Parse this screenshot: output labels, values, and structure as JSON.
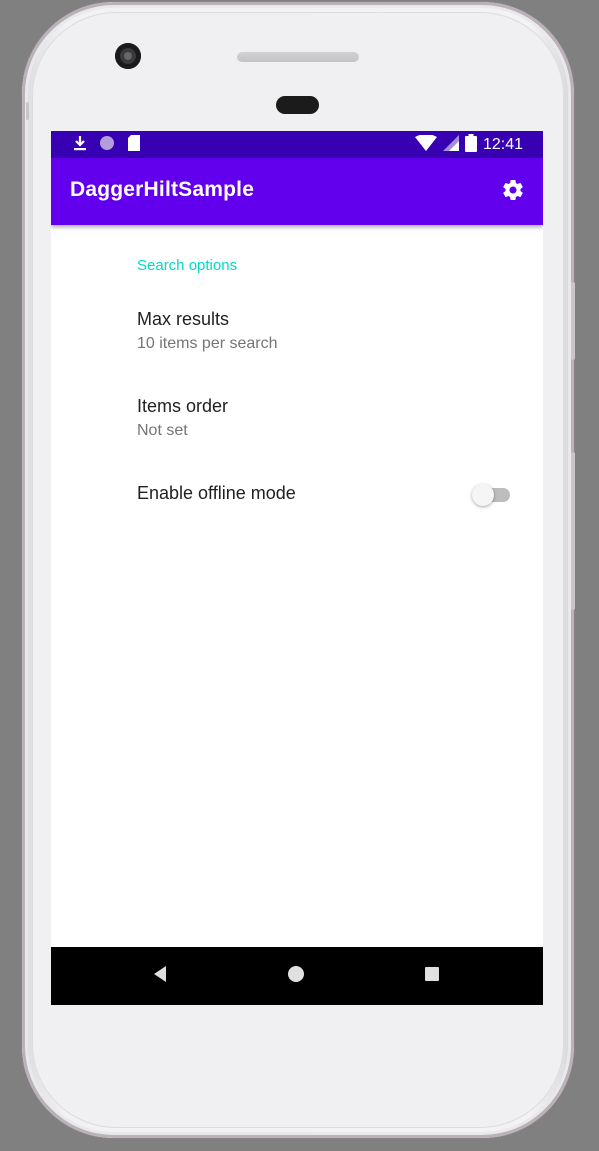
{
  "status_bar": {
    "time": "12:41",
    "left_icons": [
      "download-icon",
      "circle-notification-icon",
      "sd-card-icon"
    ],
    "right_icons": [
      "wifi-icon",
      "cell-signal-icon",
      "battery-icon"
    ]
  },
  "app_bar": {
    "title": "DaggerHiltSample",
    "action_icon": "settings-gear-icon",
    "color": "#6200ee",
    "status_color": "#3700b3"
  },
  "preferences": {
    "category_title": "Search options",
    "category_color": "#03dac5",
    "items": [
      {
        "title": "Max results",
        "summary": "10 items per search"
      },
      {
        "title": "Items order",
        "summary": "Not set"
      },
      {
        "title": "Enable offline mode",
        "switch_on": false
      }
    ]
  },
  "nav_bar": {
    "buttons": [
      "back-icon",
      "home-icon",
      "recents-icon"
    ]
  }
}
